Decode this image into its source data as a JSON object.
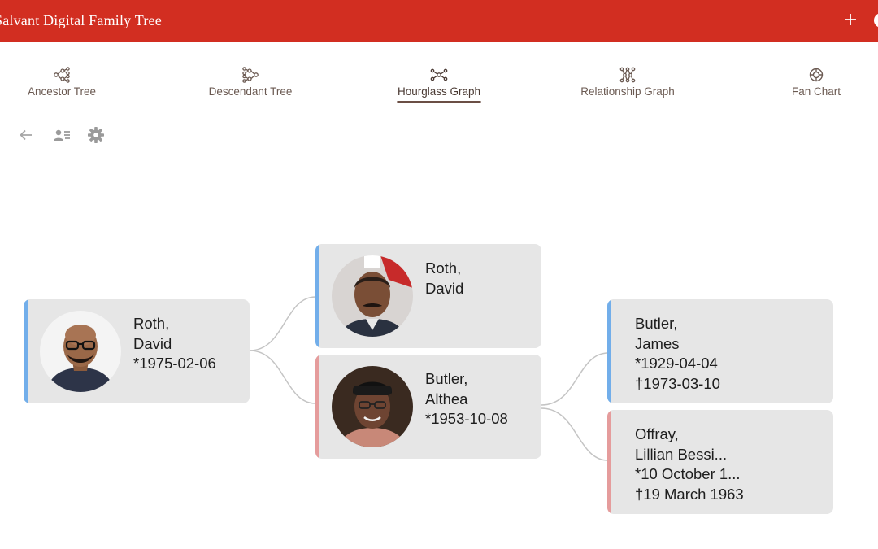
{
  "app": {
    "title": "Salvant Digital Family Tree",
    "accent_color": "#d22e21",
    "add_icon": "plus-icon"
  },
  "tabs": [
    {
      "label": "Ancestor Tree",
      "icon": "ancestor-tree-icon",
      "active": false
    },
    {
      "label": "Descendant Tree",
      "icon": "descendant-tree-icon",
      "active": false
    },
    {
      "label": "Hourglass Graph",
      "icon": "hourglass-graph-icon",
      "active": true
    },
    {
      "label": "Relationship Graph",
      "icon": "relationship-graph-icon",
      "active": false
    },
    {
      "label": "Fan Chart",
      "icon": "fan-chart-icon",
      "active": false
    }
  ],
  "toolbar": {
    "back_icon": "arrow-left-icon",
    "person_list_icon": "person-list-icon",
    "settings_icon": "gear-icon"
  },
  "people": {
    "home": {
      "surname": "Roth,",
      "given": "David",
      "birth": "*1975-02-06",
      "death": "",
      "gender": "male"
    },
    "father": {
      "surname": "Roth,",
      "given": "David",
      "birth": "",
      "death": "",
      "gender": "male"
    },
    "mother": {
      "surname": "Butler,",
      "given": "Althea",
      "birth": "*1953-10-08",
      "death": "",
      "gender": "female"
    },
    "maternal_grandfather": {
      "surname": "Butler,",
      "given": "James",
      "birth": "*1929-04-04",
      "death": "†1973-03-10",
      "gender": "male"
    },
    "maternal_grandmother": {
      "surname": "Offray,",
      "given": "Lillian Bessi...",
      "birth": "*10 October 1...",
      "death": "†19 March 1963",
      "gender": "female"
    }
  },
  "colors": {
    "male": "#72aeea",
    "female": "#e59c9c",
    "card_bg": "#e6e6e6"
  }
}
